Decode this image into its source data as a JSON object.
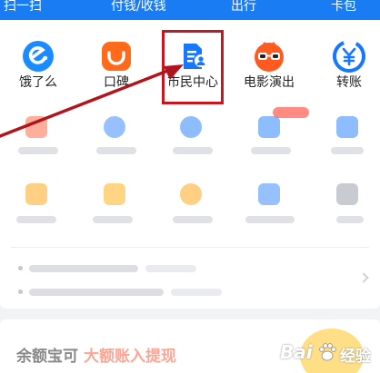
{
  "topbar": {
    "items": [
      {
        "label": "扫一扫"
      },
      {
        "label": "付钱/收钱"
      },
      {
        "label": "出行"
      },
      {
        "label": "卡包"
      }
    ]
  },
  "apps": [
    {
      "label": "饿了么",
      "icon": "eleme-icon",
      "color": "#1a8cff"
    },
    {
      "label": "口碑",
      "icon": "koubei-smile-icon",
      "color": "#ff6a1a"
    },
    {
      "label": "市民中心",
      "icon": "citizen-center-icon",
      "color": "#1677ff"
    },
    {
      "label": "电影演出",
      "icon": "movie-glasses-icon",
      "color": "#ff5a1f"
    },
    {
      "label": "转账",
      "icon": "transfer-yen-icon",
      "color": "#1677ff"
    }
  ],
  "colors": {
    "brand_blue": "#1a7cf2",
    "highlight_red": "#c9151e",
    "arrow_red": "#b0141c"
  },
  "watermark": {
    "brand": "Bai",
    "suffix": "经验",
    "paw": "paw-icon"
  },
  "promo": {
    "text_main": "余额宝可",
    "text_accent": "大额账入提现"
  }
}
